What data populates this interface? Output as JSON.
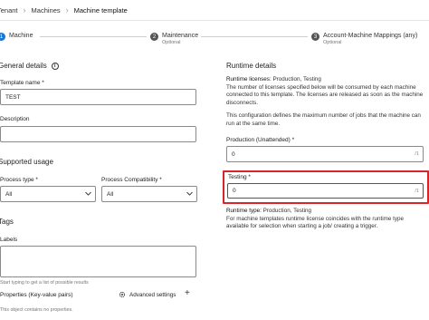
{
  "breadcrumb": {
    "items": [
      "Tenant",
      "Machines",
      "Machine template"
    ]
  },
  "stepper": {
    "steps": [
      {
        "number": "1",
        "label": "Machine",
        "sub": ""
      },
      {
        "number": "2",
        "label": "Maintenance",
        "sub": "Optional"
      },
      {
        "number": "3",
        "label": "Account-Machine Mappings (any)",
        "sub": "Optional"
      }
    ]
  },
  "general": {
    "title": "General details",
    "info_icon_glyph": "i",
    "template_name_label": "Template name *",
    "template_name_value": "TEST",
    "description_label": "Description",
    "description_value": ""
  },
  "supported_usage": {
    "title": "Supported usage",
    "process_type_label": "Process type *",
    "process_type_value": "All",
    "process_compat_label": "Process Compatibility *",
    "process_compat_value": "All"
  },
  "tags": {
    "title": "Tags",
    "labels_label": "Labels",
    "labels_hint": "Start typing to get a list of possible results",
    "properties_label": "Properties (Key-value pairs)",
    "advanced_settings": "Advanced settings",
    "add_glyph": "+",
    "empty_text": "This object contains no properties."
  },
  "runtime": {
    "title": "Runtime details",
    "licenses_heading": "Runtime licenses:",
    "licenses_value": "Production, Testing",
    "licenses_desc": "The number of licenses specified below will be consumed by each machine connected to this template. The licenses are released as soon as the machine disconnects.",
    "config_desc": "This configuration defines the maximum number of jobs that the machine can run at the same time.",
    "production_label": "Production (Unattended) *",
    "production_value": "0",
    "production_suffix": "/1",
    "testing_label": "Testing *",
    "testing_value": "0",
    "testing_suffix": "/1",
    "type_heading": "Runtime type:",
    "type_value": "Production, Testing",
    "type_desc": "For machine templates runtime license coincides with the runtime type available for selection when starting a job/ creating a trigger."
  },
  "colors": {
    "accent": "#1976d2",
    "highlight": "#d9242b"
  }
}
